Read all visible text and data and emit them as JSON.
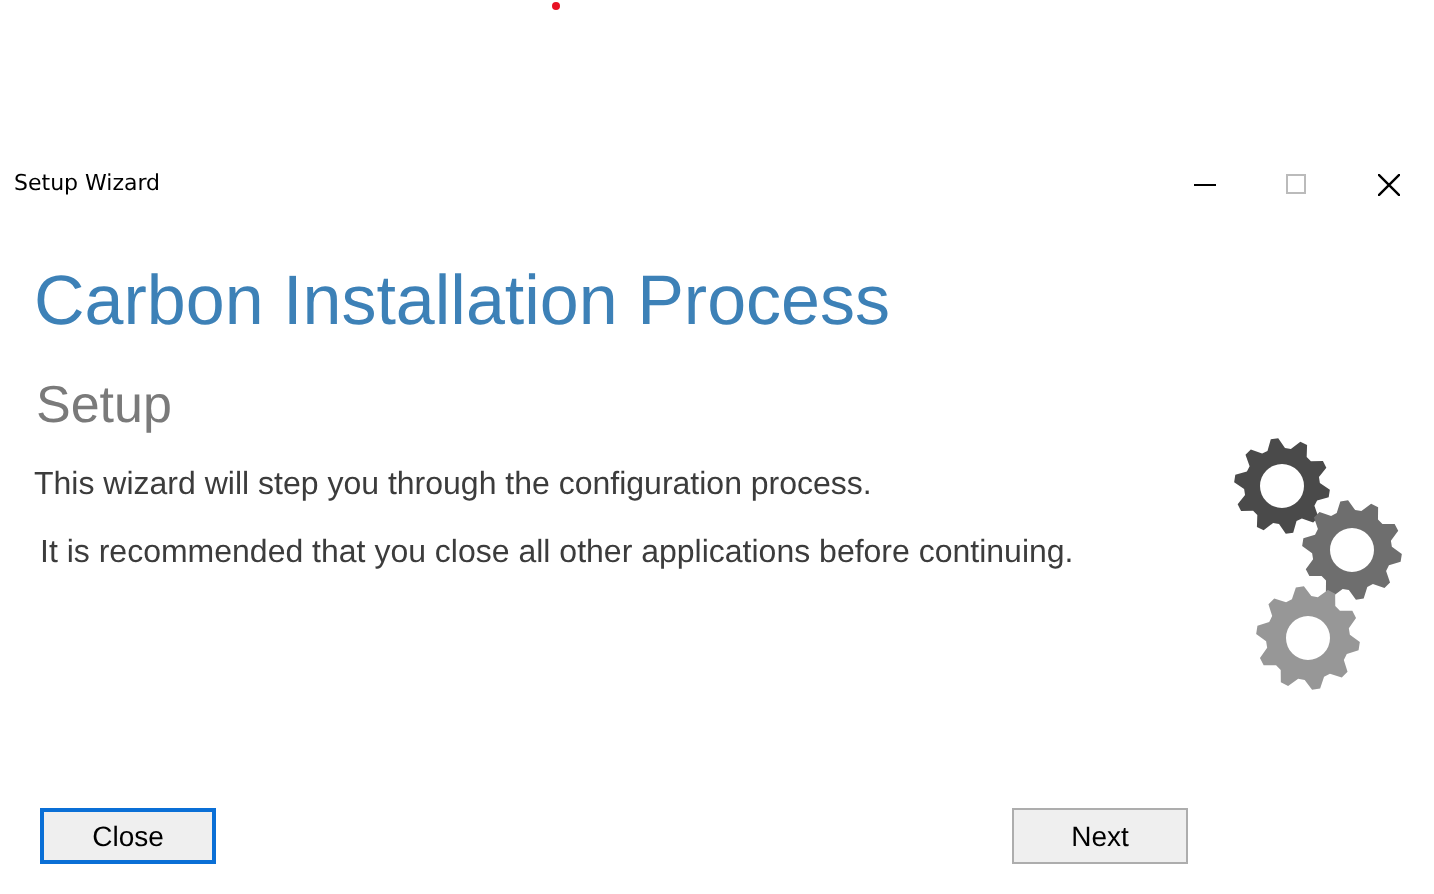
{
  "window": {
    "title": "Setup Wizard"
  },
  "heading": "Carbon Installation Process",
  "subheading": "Setup",
  "paragraphs": [
    "This wizard will step you through the configuration process.",
    "It is recommended that you close all other applications before continuing."
  ],
  "buttons": [
    {
      "label": "Close",
      "focused": true
    },
    {
      "label": "Next",
      "focused": false
    }
  ]
}
